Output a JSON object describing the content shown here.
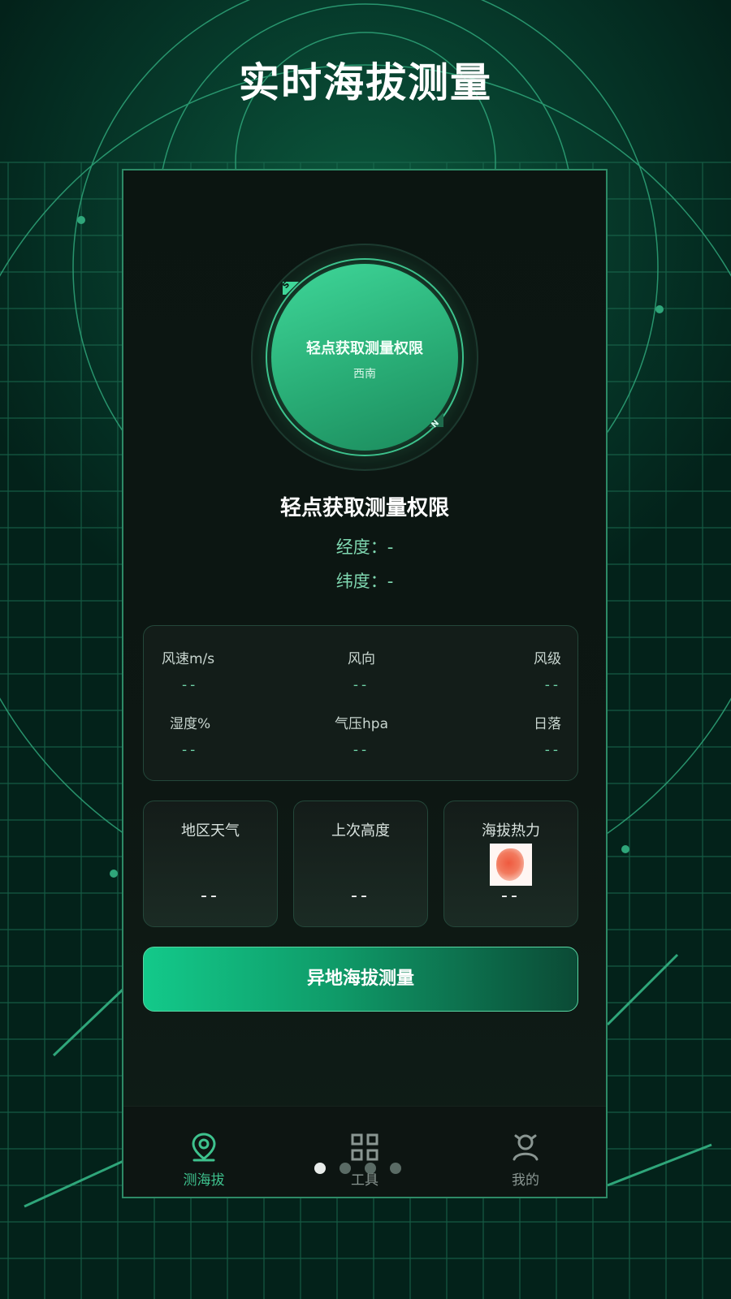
{
  "headline": "实时海拔测量",
  "dial": {
    "title": "轻点获取测量权限",
    "direction": "西南",
    "marker_s": "S",
    "marker_n": "N"
  },
  "status": {
    "title": "轻点获取测量权限",
    "longitude": "经度：-",
    "latitude": "纬度：-"
  },
  "weather": {
    "wind_speed": {
      "label": "风速m/s",
      "value": "--"
    },
    "wind_direction": {
      "label": "风向",
      "value": "--"
    },
    "wind_level": {
      "label": "风级",
      "value": "--"
    },
    "humidity": {
      "label": "湿度%",
      "value": "--"
    },
    "pressure": {
      "label": "气压hpa",
      "value": "--"
    },
    "sunset": {
      "label": "日落",
      "value": "--"
    }
  },
  "cards": [
    {
      "label": "地区天气",
      "value": "--"
    },
    {
      "label": "上次高度",
      "value": "--"
    },
    {
      "label": "海拔热力",
      "value": "--"
    }
  ],
  "cta": {
    "label": "异地海拔测量"
  },
  "tabs": [
    {
      "label": "测海拔",
      "icon": "location-pin-icon",
      "active": true
    },
    {
      "label": "工具",
      "icon": "grid-icon",
      "active": false
    },
    {
      "label": "我的",
      "icon": "user-icon",
      "active": false
    }
  ],
  "colors": {
    "accent": "#3fd799",
    "active_tab": "#3ec28e",
    "inactive_tab": "#8a9692",
    "background": "#04251b"
  },
  "pagination": {
    "current": 1,
    "total": 4
  }
}
